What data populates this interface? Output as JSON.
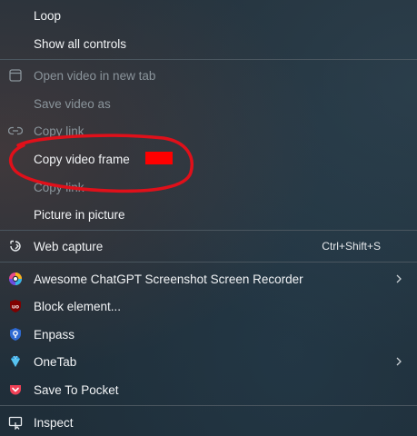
{
  "menu": {
    "loop": "Loop",
    "show_all_controls": "Show all controls",
    "open_video_new_tab": "Open video in new tab",
    "save_video_as": "Save video as",
    "copy_link_1": "Copy link",
    "copy_video_frame": "Copy video frame",
    "copy_link_2": "Copy link",
    "picture_in_picture": "Picture in picture",
    "web_capture": "Web capture",
    "web_capture_shortcut": "Ctrl+Shift+S",
    "awesome_chatgpt": "Awesome ChatGPT Screenshot  Screen Recorder",
    "block_element": "Block element...",
    "enpass": "Enpass",
    "onetab": "OneTab",
    "save_to_pocket": "Save To Pocket",
    "inspect": "Inspect"
  },
  "icons": {
    "open_video": "window-icon",
    "copy_link": "link-icon",
    "web_capture": "web-capture-icon",
    "awesome_chatgpt": "awesome-screenshot-icon",
    "block_element": "ublock-icon",
    "enpass": "enpass-icon",
    "onetab": "onetab-icon",
    "pocket": "pocket-icon",
    "inspect": "inspect-icon",
    "submenu": "chevron-right-icon"
  },
  "colors": {
    "annotation": "#e0101a",
    "redacted_block": "#ff0000",
    "pocket": "#ef4056",
    "ublock": "#800000",
    "enpass": "#2e6ad3",
    "onetab": "#2f9bd8"
  }
}
